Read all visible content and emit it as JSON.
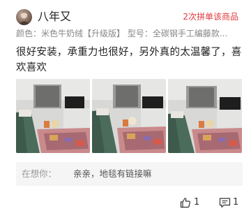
{
  "review": {
    "username": "八年又",
    "buy_badge": "2次拼单该商品",
    "spec_line": "颜色：米色牛奶绒【升级版】 型号：全碳钢手工编藤款...",
    "text": "很好安装，承重力也很好，另外真的太温馨了，喜欢喜欢",
    "photos": [
      {
        "alt": "living room photo 1"
      },
      {
        "alt": "living room photo 2"
      },
      {
        "alt": "living room photo 3"
      }
    ]
  },
  "reply": {
    "user": "在想你：",
    "text": "亲亲，地毯有链接嘛"
  },
  "actions": {
    "like_count": "1",
    "comment_count": "1"
  },
  "colors": {
    "badge": "#e0393e",
    "spec": "#888888",
    "reply_bg": "#f5f5f5"
  },
  "icons": {
    "like": "thumbs-up-icon",
    "comment": "comment-icon"
  }
}
